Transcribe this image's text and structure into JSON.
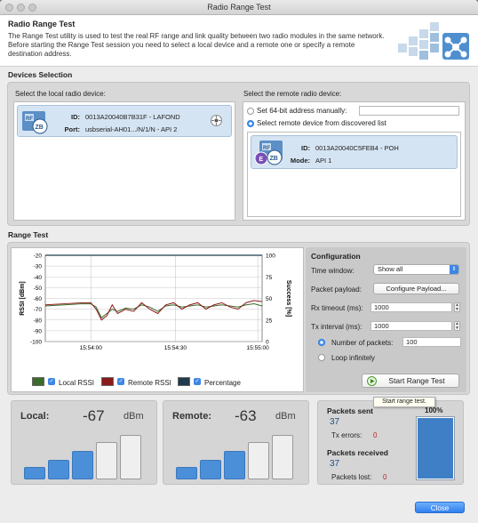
{
  "window": {
    "title": "Radio Range Test"
  },
  "header": {
    "title": "Radio Range Test",
    "description": "The Range Test utility is used to test the real RF range and link quality between two radio modules in the same network. Before starting the Range Test session you need to select a local device and a remote one or specify a remote destination address."
  },
  "devices": {
    "section_title": "Devices Selection",
    "local_label": "Select the local radio device:",
    "local": {
      "id_key": "ID:",
      "id": "0013A20040B7B31F - LAFOND",
      "port_key": "Port:",
      "port": "usbserial-AH01.../N/1/N - API 2",
      "badge": "ZB"
    },
    "remote_label": "Select the remote radio device:",
    "manual_option": "Set 64-bit address manually:",
    "manual_value": "",
    "discovered_option": "Select remote device from discovered list",
    "remote": {
      "id_key": "ID:",
      "id": "0013A20040C5FEB4 - POH",
      "mode_key": "Mode:",
      "mode": "API 1",
      "badge": "ZB",
      "badge2": "E"
    }
  },
  "range_test": {
    "section_title": "Range Test",
    "legend": {
      "local": "Local RSSI",
      "remote": "Remote RSSI",
      "percentage": "Percentage"
    },
    "config": {
      "title": "Configuration",
      "time_window_label": "Time window:",
      "time_window_value": "Show all",
      "payload_label": "Packet payload:",
      "payload_button": "Configure Payload...",
      "rx_timeout_label": "Rx timeout (ms):",
      "rx_timeout_value": "1000",
      "tx_interval_label": "Tx interval (ms):",
      "tx_interval_value": "1000",
      "num_packets_label": "Number of packets:",
      "num_packets_value": "100",
      "loop_label": "Loop infinitely",
      "start_button": "Start Range Test",
      "tooltip": "Start range test."
    }
  },
  "signal": {
    "local": {
      "label": "Local:",
      "value": "-67",
      "unit": "dBm",
      "bars_filled": 3,
      "bars_total": 5
    },
    "remote": {
      "label": "Remote:",
      "value": "-63",
      "unit": "dBm",
      "bars_filled": 3,
      "bars_total": 5
    }
  },
  "packets": {
    "sent_label": "Packets sent",
    "sent_value": "37",
    "tx_errors_label": "Tx errors:",
    "tx_errors_value": "0",
    "received_label": "Packets received",
    "received_value": "37",
    "lost_label": "Packets lost:",
    "lost_value": "0",
    "percent_label": "100%",
    "percent": 100
  },
  "footer": {
    "close_button": "Close"
  },
  "colors": {
    "accent": "#3f86e4",
    "local_rssi": "#3a6b2a",
    "remote_rssi": "#8b1a1a",
    "percentage": "#1f3b4d"
  },
  "chart_data": {
    "type": "line",
    "xlabel": "",
    "ylabel": "RSSI [dBm]",
    "y2label": "Success [%]",
    "ylim": [
      -100,
      -20
    ],
    "y2lim": [
      0,
      100
    ],
    "yticks": [
      -20,
      -30,
      -40,
      -50,
      -60,
      -70,
      -80,
      -90,
      -100
    ],
    "y2ticks": [
      100,
      75,
      50,
      25,
      0
    ],
    "xticks": [
      "15:54:00",
      "15:54:30",
      "15:55:00"
    ],
    "xtick_positions": [
      0.21,
      0.6,
      0.98
    ],
    "x_range_seconds": [
      -17,
      64
    ],
    "grid": true,
    "series": [
      {
        "name": "Local RSSI",
        "color": "#3a6b2a",
        "axis": "left",
        "x": [
          -17,
          -10,
          -3,
          0,
          2,
          4,
          6,
          8,
          10,
          13,
          16,
          19,
          22,
          25,
          28,
          31,
          34,
          37,
          40,
          43,
          46,
          49,
          52,
          55,
          58,
          61,
          64
        ],
        "y": [
          -67,
          -66,
          -65,
          -65,
          -68,
          -78,
          -74,
          -70,
          -72,
          -69,
          -70,
          -66,
          -68,
          -72,
          -67,
          -66,
          -68,
          -67,
          -66,
          -68,
          -67,
          -66,
          -67,
          -68,
          -66,
          -65,
          -67
        ]
      },
      {
        "name": "Remote RSSI",
        "color": "#8b1a1a",
        "axis": "left",
        "x": [
          -17,
          -10,
          -3,
          0,
          2,
          4,
          6,
          8,
          10,
          13,
          16,
          19,
          22,
          25,
          28,
          31,
          34,
          37,
          40,
          43,
          46,
          49,
          52,
          55,
          58,
          61,
          64
        ],
        "y": [
          -66,
          -65,
          -64,
          -64,
          -70,
          -80,
          -76,
          -66,
          -74,
          -70,
          -72,
          -64,
          -70,
          -74,
          -66,
          -64,
          -70,
          -66,
          -64,
          -70,
          -66,
          -64,
          -68,
          -70,
          -64,
          -62,
          -63
        ]
      },
      {
        "name": "Percentage",
        "color": "#1f3b4d",
        "axis": "right",
        "x": [
          -17,
          64
        ],
        "y": [
          100,
          100
        ]
      }
    ]
  }
}
